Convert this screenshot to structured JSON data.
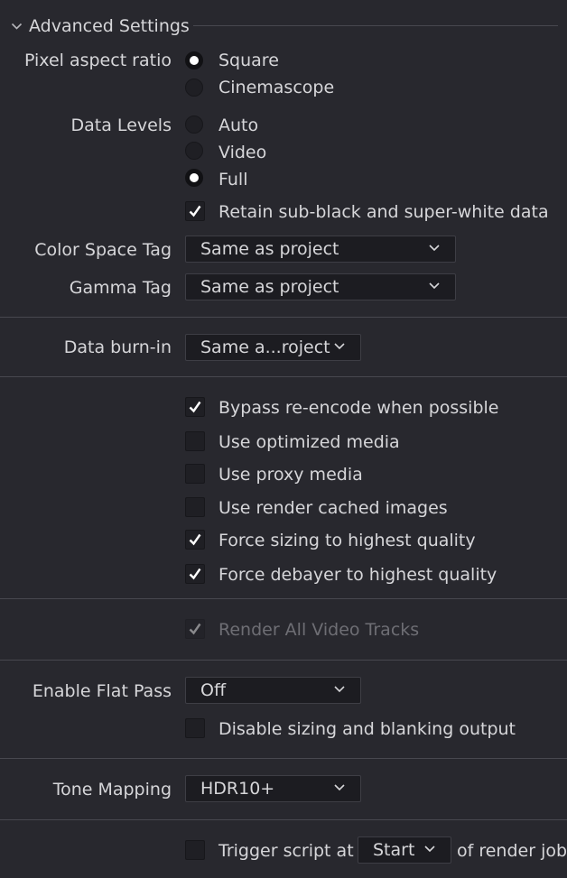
{
  "section": {
    "title": "Advanced Settings"
  },
  "pixel_aspect": {
    "label": "Pixel aspect ratio",
    "options": [
      {
        "label": "Square",
        "selected": true
      },
      {
        "label": "Cinemascope",
        "selected": false
      }
    ]
  },
  "data_levels": {
    "label": "Data Levels",
    "options": [
      {
        "label": "Auto",
        "selected": false
      },
      {
        "label": "Video",
        "selected": false
      },
      {
        "label": "Full",
        "selected": true
      }
    ],
    "retain": {
      "label": "Retain sub-black and super-white data",
      "checked": true
    }
  },
  "color_space_tag": {
    "label": "Color Space Tag",
    "value": "Same as project"
  },
  "gamma_tag": {
    "label": "Gamma Tag",
    "value": "Same as project"
  },
  "data_burn_in": {
    "label": "Data burn-in",
    "value": "Same a...roject"
  },
  "options": [
    {
      "label": "Bypass re-encode when possible",
      "checked": true
    },
    {
      "label": "Use optimized media",
      "checked": false
    },
    {
      "label": "Use proxy media",
      "checked": false
    },
    {
      "label": "Use render cached images",
      "checked": false
    },
    {
      "label": "Force sizing to highest quality",
      "checked": true
    },
    {
      "label": "Force debayer to highest quality",
      "checked": true
    }
  ],
  "render_all_tracks": {
    "label": "Render All Video Tracks",
    "checked": true,
    "disabled": true
  },
  "flat_pass": {
    "label": "Enable Flat Pass",
    "value": "Off",
    "disable_sizing": {
      "label": "Disable sizing and blanking output",
      "checked": false
    }
  },
  "tone_mapping": {
    "label": "Tone Mapping",
    "value": "HDR10+"
  },
  "trigger": {
    "label": "Trigger script at",
    "value": "Start",
    "suffix": "of render job",
    "checked": false
  },
  "colors": {
    "background": "#28282e",
    "field": "#1c1c21",
    "text": "#d6d6d9",
    "separator": "#48484f"
  },
  "icons": {
    "collapse": "chevron-down-icon",
    "dropdown": "chevron-down-icon",
    "check": "check-icon"
  }
}
